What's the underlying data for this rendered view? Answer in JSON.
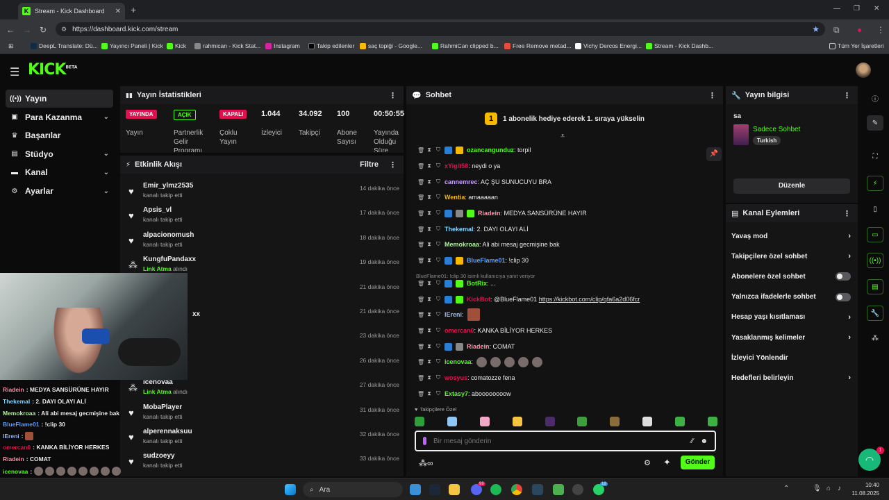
{
  "browser": {
    "tab_title": "Stream - Kick Dashboard",
    "url": "https://dashboard.kick.com/stream",
    "bookmarks": [
      "DeepL Translate: Dü...",
      "Yayıncı Paneli | Kick",
      "Kick",
      "rahmican - Kick Stat...",
      "Instagram",
      "Takip edilenler",
      "saç topiği - Google...",
      "RahmiCan clipped b...",
      "Free Remove metad...",
      "Vichy Dercos Energi...",
      "Stream - Kick Dashb..."
    ],
    "all_bookmarks": "Tüm Yer İşaretleri"
  },
  "logo": {
    "text": "KICK",
    "sup": "BETA"
  },
  "sidebar": [
    {
      "label": "Yayın",
      "icon": "broadcast-icon",
      "active": true,
      "chev": false
    },
    {
      "label": "Para Kazanma",
      "icon": "money-icon",
      "chev": true
    },
    {
      "label": "Başarılar",
      "icon": "trophy-icon",
      "chev": false
    },
    {
      "label": "Stüdyo",
      "icon": "studio-icon",
      "chev": true
    },
    {
      "label": "Kanal",
      "icon": "channel-icon",
      "chev": true
    },
    {
      "label": "Ayarlar",
      "icon": "gear-icon",
      "chev": true
    }
  ],
  "stats": {
    "title": "Yayın İstatistikleri",
    "items": [
      {
        "badge": "YAYINDA",
        "color": "#e0114f",
        "label": "Yayın"
      },
      {
        "badge": "AÇIK",
        "color": "#53fc18",
        "label": "Partnerlik Gelir Programı"
      },
      {
        "badge": "KAPALI",
        "color": "#e0114f",
        "label": "Çoklu Yayın"
      },
      {
        "value": "1.044",
        "label": "İzleyici"
      },
      {
        "value": "34.092",
        "label": "Takipçi"
      },
      {
        "value": "100",
        "label": "Abone Sayısı"
      },
      {
        "value": "00:50:55",
        "label": "Yayında Olduğu Süre"
      }
    ]
  },
  "activity": {
    "title": "Etkinlik Akışı",
    "filter": "Filtre",
    "items": [
      {
        "name": "Emir_ylmz2535",
        "sub": "kanalı takip etti",
        "time": "14 dakika önce",
        "type": "follow"
      },
      {
        "name": "Apsis_vl",
        "sub": "kanalı takip etti",
        "time": "17 dakika önce",
        "type": "follow"
      },
      {
        "name": "alpacionomush",
        "sub": "kanalı takip etti",
        "time": "18 dakika önce",
        "type": "follow"
      },
      {
        "name": "KungfuPandaxx",
        "sub": "Link Atma",
        "sub2": " alındı",
        "time": "19 dakika önce",
        "type": "reward"
      },
      {
        "name": "",
        "sub": "",
        "time": "21 dakika önce",
        "type": "hidden"
      },
      {
        "name": "xx",
        "sub": "",
        "time": "21 dakika önce",
        "type": "hidden"
      },
      {
        "name": "",
        "sub": "",
        "time": "23 dakika önce",
        "type": "hidden"
      },
      {
        "name": "",
        "sub": "",
        "time": "26 dakika önce",
        "type": "hidden"
      },
      {
        "name": "icenovaa",
        "sub": "Link Atma",
        "sub2": " alındı",
        "time": "27 dakika önce",
        "type": "reward"
      },
      {
        "name": "MobaPlayer",
        "sub": "kanalı takip etti",
        "time": "31 dakika önce",
        "type": "follow"
      },
      {
        "name": "alperennaksuu",
        "sub": "kanalı takip etti",
        "time": "32 dakika önce",
        "type": "follow"
      },
      {
        "name": "sudzoeyy",
        "sub": "kanalı takip etti",
        "time": "33 dakika önce",
        "type": "follow"
      }
    ]
  },
  "chat": {
    "title": "Sohbet",
    "banner": "1 abonelik hediye ederek 1. sıraya yükselin",
    "banner_num": "1",
    "reply_note": "BlueFlame01: !clip 30 isimli kullanıcıya yanıt veriyor",
    "followers_only": "Takipçilere Özel",
    "placeholder": "Bir mesaj gönderin",
    "send": "Gönder",
    "messages": [
      {
        "user": "ozancangunduz",
        "color": "#53fc18",
        "text": ": torpil"
      },
      {
        "user": "xYigit58",
        "color": "#e0114f",
        "text": ": neydi o ya"
      },
      {
        "user": "cannemrec",
        "color": "#c8a0ff",
        "text": ": AÇ ŞU SUNUCUYU BRA"
      },
      {
        "user": "Wentia",
        "color": "#f5b900",
        "text": ": amaaaaan"
      },
      {
        "user": "Riadein",
        "color": "#ff8fa8",
        "text": ": MEDYA SANSÜRÜNE HAYIR"
      },
      {
        "user": "Thekemal",
        "color": "#7fd6ff",
        "text": ": 2. DAYI OLAYI ALİ"
      },
      {
        "user": "Memokroaa",
        "color": "#b3f0a0",
        "text": ": Ali abi mesaj gecmişine bak"
      },
      {
        "user": "BlueFlame01",
        "color": "#5aa0ff",
        "text": ": !clip 30"
      },
      {
        "user": "BotRix",
        "color": "#53fc18",
        "text": ": ..."
      },
      {
        "user": "KickBot",
        "color": "#e0114f",
        "text": ": @BlueFlame01 ",
        "link": "https://kickbot.com/clip/qfa6a2d06fcr"
      },
      {
        "user": "lEreni",
        "color": "#9ab8ff",
        "text": ":"
      },
      {
        "user": "omercan0",
        "color": "#e0114f",
        "text": ": KANKA BİLİYOR HERKES"
      },
      {
        "user": "Riadein",
        "color": "#ff8fa8",
        "text": ": COMAT"
      },
      {
        "user": "icenovaa",
        "color": "#53fc18",
        "text": ":"
      },
      {
        "user": "wosyus",
        "color": "#e0114f",
        "text": ": comatozze fena"
      },
      {
        "user": "Extasy7",
        "color": "#53fc18",
        "text": ": aboooooooow"
      }
    ]
  },
  "info": {
    "title": "Yayın bilgisi",
    "stream_title": "sa",
    "category": "Sadece Sohbet",
    "tag": "Turkish",
    "edit": "Düzenle"
  },
  "actions": {
    "title": "Kanal Eylemleri",
    "items": [
      {
        "label": "Yavaş mod",
        "kind": "chev"
      },
      {
        "label": "Takipçilere özel sohbet",
        "kind": "chev"
      },
      {
        "label": "Abonelere özel sohbet",
        "kind": "toggle"
      },
      {
        "label": "Yalnızca ifadelerle sohbet",
        "kind": "toggle"
      },
      {
        "label": "Hesap yaşı kısıtlaması",
        "kind": "chev"
      },
      {
        "label": "Yasaklanmış kelimeler",
        "kind": "chev"
      },
      {
        "label": "İzleyici Yönlendir",
        "kind": "none"
      },
      {
        "label": "Hedefleri belirleyin",
        "kind": "chev"
      }
    ]
  },
  "overlay": [
    {
      "user": "Riadein",
      "color": "#ff8fa8",
      "text": ": MEDYA SANSÜRÜNE HAYIR"
    },
    {
      "user": "Thekemal",
      "color": "#7fd6ff",
      "text": ": 2. DAYI OLAYI ALİ"
    },
    {
      "user": "Memokroaa",
      "color": "#b3f0a0",
      "text": ": Ali abi mesaj gecmişine bak"
    },
    {
      "user": "BlueFlame01",
      "color": "#5aa0ff",
      "text": ": !clip 30"
    },
    {
      "user": "lEreni",
      "color": "#9ab8ff",
      "text": ":"
    },
    {
      "user": "omercan0",
      "color": "#e0114f",
      "text": ": KANKA BİLİYOR HERKES"
    },
    {
      "user": "Riadein",
      "color": "#ff8fa8",
      "text": ": COMAT"
    },
    {
      "user": "icenovaa",
      "color": "#53fc18",
      "text": ":"
    },
    {
      "user": "wosyus",
      "color": "#e0114f",
      "text": ": comatozze fena"
    },
    {
      "user": "Extasy7",
      "color": "#53fc18",
      "text": ": aboooooooow"
    }
  ],
  "taskbar": {
    "search": "Ara",
    "time": "10:40",
    "date": "11.08.2025",
    "badge1": "99",
    "badge2": "18"
  },
  "help_badge": "1"
}
